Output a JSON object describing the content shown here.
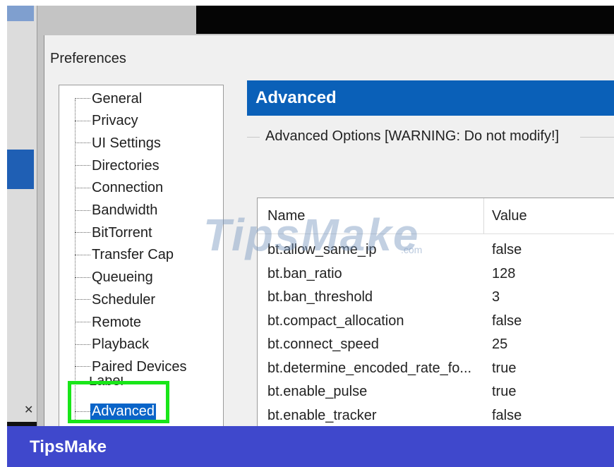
{
  "dialog": {
    "title": "Preferences"
  },
  "tree": {
    "items": [
      "General",
      "Privacy",
      "UI Settings",
      "Directories",
      "Connection",
      "Bandwidth",
      "BitTorrent",
      "Transfer Cap",
      "Queueing",
      "Scheduler",
      "Remote",
      "Playback",
      "Paired Devices"
    ],
    "partial_item": "Label",
    "selected": "Advanced"
  },
  "panel": {
    "title": "Advanced",
    "group_title": "Advanced Options [WARNING: Do not modify!]",
    "table": {
      "columns": [
        "Name",
        "Value"
      ],
      "rows": [
        {
          "name": "bt.allow_same_ip",
          "value": "false"
        },
        {
          "name": "bt.ban_ratio",
          "value": "128"
        },
        {
          "name": "bt.ban_threshold",
          "value": "3"
        },
        {
          "name": "bt.compact_allocation",
          "value": "false"
        },
        {
          "name": "bt.connect_speed",
          "value": "25"
        },
        {
          "name": "bt.determine_encoded_rate_fo...",
          "value": "true"
        },
        {
          "name": "bt.enable_pulse",
          "value": "true"
        },
        {
          "name": "bt.enable_tracker",
          "value": "false"
        }
      ]
    }
  },
  "watermark": {
    "text": "TipsMake",
    "suffix": ".com"
  },
  "footer": {
    "brand": "TipsMake"
  },
  "colors": {
    "header_blue": "#0a60b8",
    "selection_blue": "#0a64c8",
    "highlight_green": "#19e619",
    "footer_blue": "#3f48cc"
  }
}
